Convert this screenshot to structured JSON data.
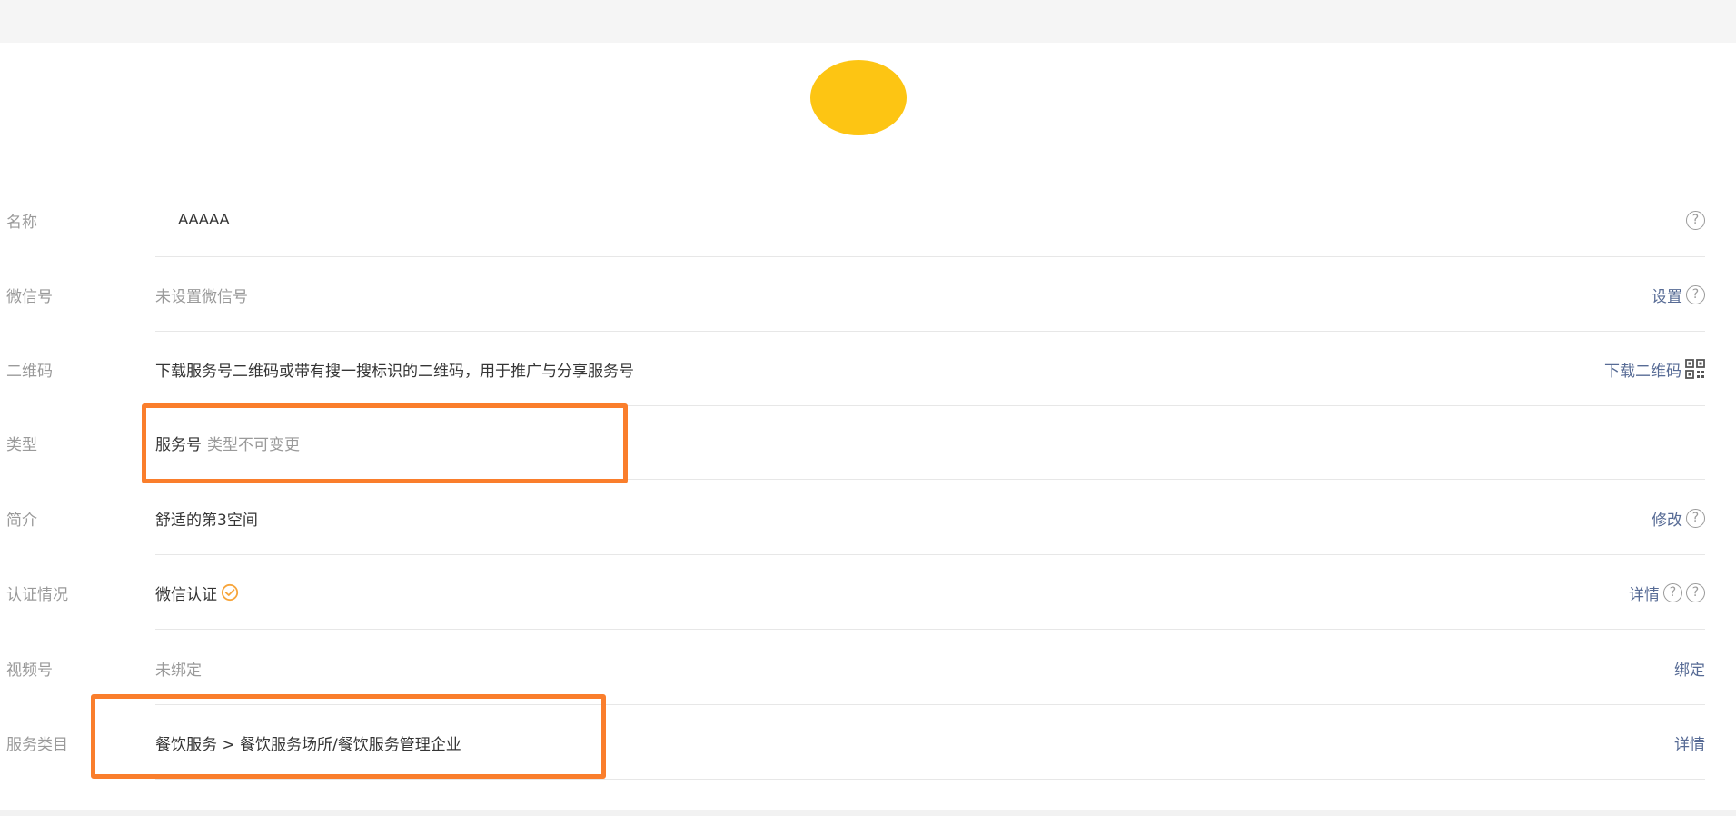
{
  "profile": {
    "avatar_color": "#fdc513"
  },
  "rows": {
    "name": {
      "label": "名称",
      "value": "AAAAA"
    },
    "wechat_id": {
      "label": "微信号",
      "value": "未设置微信号",
      "action": "设置"
    },
    "qrcode": {
      "label": "二维码",
      "value": "下载服务号二维码或带有搜一搜标识的二维码，用于推广与分享服务号",
      "action": "下载二维码"
    },
    "type": {
      "label": "类型",
      "value": "服务号",
      "note": "类型不可变更"
    },
    "intro": {
      "label": "简介",
      "value": "舒适的第3空间",
      "action": "修改"
    },
    "verification": {
      "label": "认证情况",
      "value": "微信认证",
      "action": "详情"
    },
    "channels": {
      "label": "视频号",
      "value": "未绑定",
      "action": "绑定"
    },
    "service_category": {
      "label": "服务类目",
      "value": "餐饮服务 > 餐饮服务场所/餐饮服务管理企业",
      "action": "详情"
    }
  },
  "colors": {
    "link": "#576b95",
    "highlight": "#fa7e2c",
    "verified": "#f7a53b"
  },
  "icons": {
    "help": "question-circle-icon",
    "qr": "qr-code-icon",
    "verified": "verified-check-icon"
  }
}
